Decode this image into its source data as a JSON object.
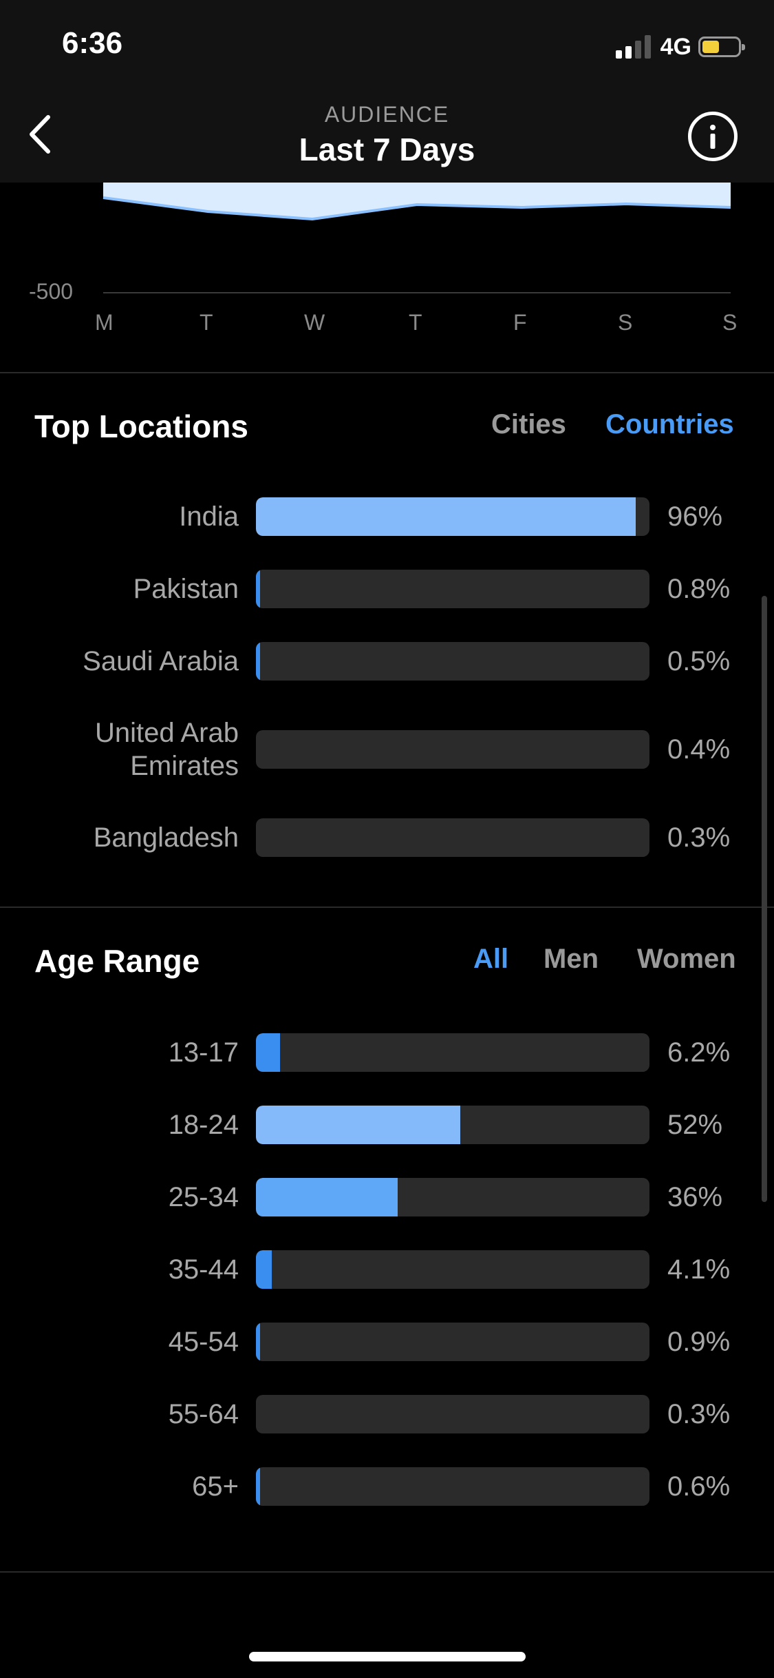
{
  "status_bar": {
    "time": "6:36",
    "network": "4G",
    "battery_color": "#f2cf3b"
  },
  "header": {
    "subtitle": "AUDIENCE",
    "title": "Last 7 Days",
    "back_icon": "chevron-left-icon",
    "info_icon": "info-icon"
  },
  "chart_data": {
    "type": "area",
    "x": [
      "M",
      "T",
      "W",
      "T",
      "F",
      "S",
      "S"
    ],
    "y_tick_visible": "-500",
    "accent": "#8bc0ff",
    "fill": "#dcecff"
  },
  "top_locations": {
    "title": "Top Locations",
    "tabs": [
      {
        "label": "Cities",
        "active": false
      },
      {
        "label": "Countries",
        "active": true
      }
    ],
    "rows": [
      {
        "label": "India",
        "value": "96%",
        "fraction": 0.965,
        "color": "#84b9fa"
      },
      {
        "label": "Pakistan",
        "value": "0.8%",
        "fraction": 0.01,
        "color": "#3a8ef0"
      },
      {
        "label": "Saudi Arabia",
        "value": "0.5%",
        "fraction": 0.008,
        "color": "#3a8ef0"
      },
      {
        "label": "United Arab Emirates",
        "value": "0.4%",
        "fraction": 0.0,
        "color": "#3a8ef0"
      },
      {
        "label": "Bangladesh",
        "value": "0.3%",
        "fraction": 0.0,
        "color": "#3a8ef0"
      }
    ]
  },
  "age_range": {
    "title": "Age Range",
    "tabs": [
      {
        "label": "All",
        "active": true
      },
      {
        "label": "Men",
        "active": false
      },
      {
        "label": "Women",
        "active": false
      }
    ],
    "rows": [
      {
        "label": "13-17",
        "value": "6.2%",
        "fraction": 0.062,
        "color": "#3a8ef0"
      },
      {
        "label": "18-24",
        "value": "52%",
        "fraction": 0.52,
        "color": "#84b9fa"
      },
      {
        "label": "25-34",
        "value": "36%",
        "fraction": 0.36,
        "color": "#5fa8f7"
      },
      {
        "label": "35-44",
        "value": "4.1%",
        "fraction": 0.041,
        "color": "#3a8ef0"
      },
      {
        "label": "45-54",
        "value": "0.9%",
        "fraction": 0.01,
        "color": "#3a8ef0"
      },
      {
        "label": "55-64",
        "value": "0.3%",
        "fraction": 0.0,
        "color": "#3a8ef0"
      },
      {
        "label": "65+",
        "value": "0.6%",
        "fraction": 0.01,
        "color": "#3a8ef0"
      }
    ]
  }
}
